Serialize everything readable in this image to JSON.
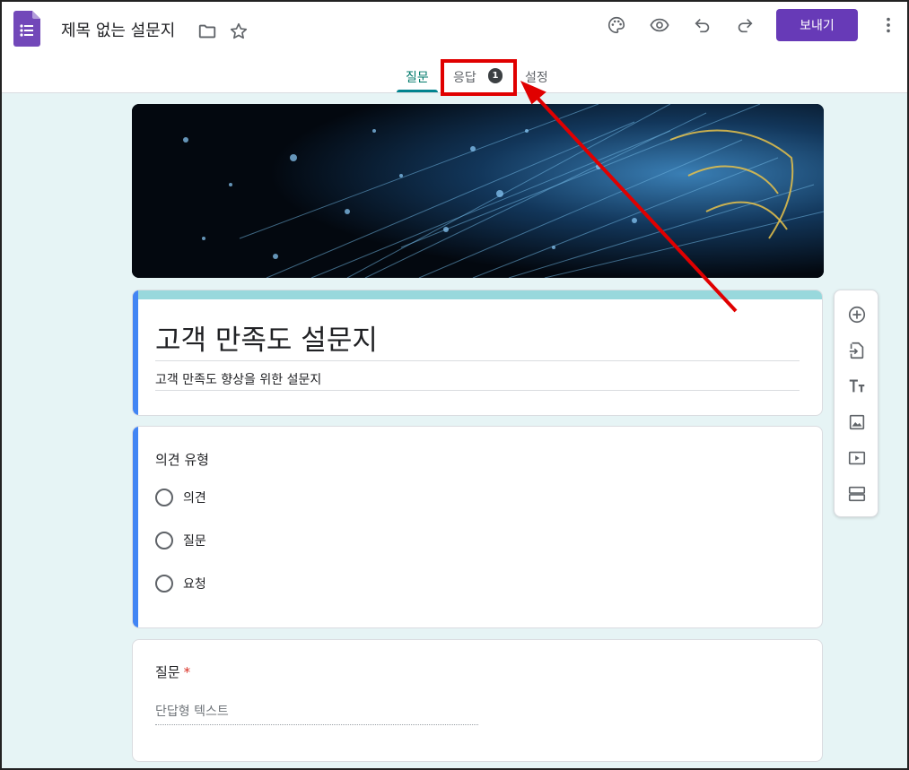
{
  "header": {
    "doc_title": "제목 없는 설문지",
    "send_label": "보내기",
    "accent_color": "#673ab7"
  },
  "tabs": [
    {
      "label": "질문",
      "active": true
    },
    {
      "label": "응답",
      "badge": "1"
    },
    {
      "label": "설정"
    }
  ],
  "form": {
    "title": "고객 만족도 설문지",
    "description": "고객 만족도 향상을 위한 설문지",
    "theme_color": "#98d8dc"
  },
  "questions": [
    {
      "title": "의견 유형",
      "options": [
        "의견",
        "질문",
        "요청"
      ]
    },
    {
      "title": "질문",
      "required_mark": "*",
      "placeholder": "단답형 텍스트"
    }
  ],
  "toolbar_icons": [
    "add-question-icon",
    "import-questions-icon",
    "add-title-icon",
    "add-image-icon",
    "add-video-icon",
    "add-section-icon"
  ],
  "header_icons": [
    "folder-icon",
    "star-icon",
    "palette-icon",
    "preview-eye-icon",
    "undo-icon",
    "redo-icon",
    "more-vert-icon"
  ]
}
